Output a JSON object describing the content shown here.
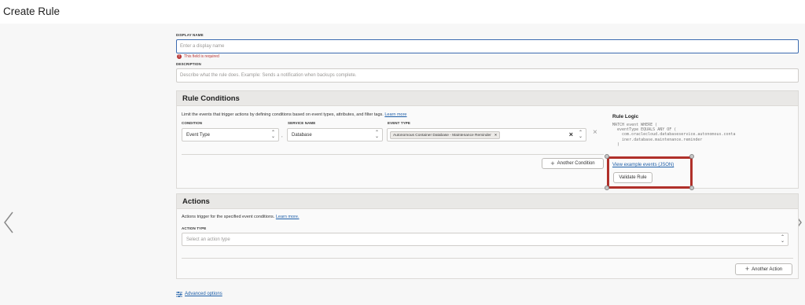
{
  "page_title": "Create Rule",
  "display_name": {
    "label": "DISPLAY NAME",
    "placeholder": "Enter a display name",
    "error": "This field is required"
  },
  "description": {
    "label": "DESCRIPTION",
    "placeholder": "Describe what the rule does. Example: Sends a notification when backups complete."
  },
  "rule_conditions": {
    "title": "Rule Conditions",
    "intro": "Limit the events that trigger actions by defining conditions based on event types, attributes, and filter tags.",
    "learn_more": "Learn more",
    "columns": {
      "condition": "CONDITION",
      "service_name": "SERVICE NAME",
      "event_type": "EVENT TYPE"
    },
    "row": {
      "condition_value": "Event Type",
      "service_value": "Database",
      "event_type_chip": "Autonomous Container Database - Maintenance Reminder",
      "chip_remove": "×",
      "clear_all": "×",
      "remove_row": "×",
      "separator": ","
    },
    "another_condition": "Another Condition",
    "rule_logic": {
      "title": "Rule Logic",
      "code": "MATCH event WHERE (\n  eventType EQUALS ANY OF (\n    com.oraclecloud.databaseservice.autonomous.conta\n    iner.database.maintenance.reminder\n  )"
    },
    "view_example_events": "View example events (JSON)",
    "validate_rule": "Validate Rule"
  },
  "actions": {
    "title": "Actions",
    "intro": "Actions trigger for the specified event conditions.",
    "learn_more": "Learn more.",
    "action_type_label": "ACTION TYPE",
    "action_type_placeholder": "Select an action type",
    "another_action": "Another Action"
  },
  "advanced_options": "Advanced options",
  "colors": {
    "highlight": "#b0302a",
    "link": "#1d5ea8",
    "error": "#b93737"
  }
}
